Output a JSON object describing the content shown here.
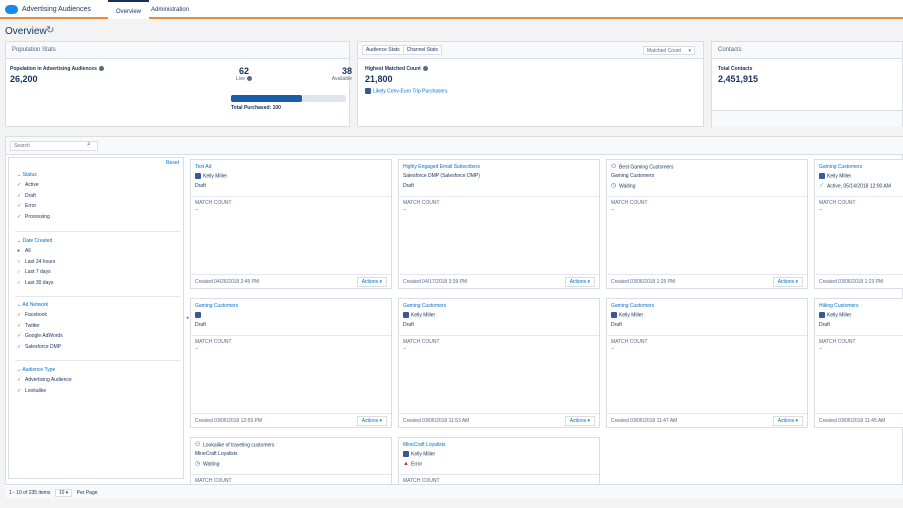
{
  "header": {
    "app_name": "Advertising Audiences",
    "tabs": [
      "Overview",
      "Administration"
    ]
  },
  "page": {
    "title": "Overview"
  },
  "population": {
    "head": "Population Stats",
    "label": "Population in Advertising Audiences",
    "value": "26,200",
    "live_value": "62",
    "live_label": "Live",
    "available_value": "38",
    "available_label": "Available",
    "total_purchased": "Total Purchased: 100",
    "live_fraction": 0.62
  },
  "audience_stats": {
    "tab1": "Audience Stats",
    "tab2": "Channel Stats",
    "select": "Matched Count",
    "label": "Highest Matched Count",
    "value": "21,800",
    "link": "Likely Conv-Euro Trip Purchasers"
  },
  "contacts": {
    "head": "Contacts",
    "label": "Total Contacts",
    "value": "2,451,915"
  },
  "search": {
    "placeholder": "Search"
  },
  "filters": {
    "reset": "Reset",
    "status": {
      "title": "Status",
      "items": [
        "Active",
        "Draft",
        "Error",
        "Processing"
      ]
    },
    "date_created": {
      "title": "Date Created",
      "items": [
        "All",
        "Last 24 hours",
        "Last 7 days",
        "Last 30 days"
      ]
    },
    "ad_network": {
      "title": "Ad Network",
      "items": [
        "Facebook",
        "Twitter",
        "Google AdWords",
        "Salesforce DMP"
      ]
    },
    "audience_type": {
      "title": "Audience Type",
      "items": [
        "Advertising Audience",
        "Lookalike"
      ]
    }
  },
  "cards": [
    {
      "title": "Test Ad",
      "line2": "Kelly Miller",
      "line3": "Draft",
      "mc": "MATCH COUNT",
      "mcv": "--",
      "created": "Created 04/26/2018 2:45 PM",
      "actions": "Actions ▾"
    },
    {
      "title": "Highly Engaged Email Subscribers",
      "line2": "Salesforce DMP (Salesforce DMP)",
      "line3": "Draft",
      "mc": "MATCH COUNT",
      "mcv": "--",
      "created": "Created 04/17/2018 3:39 PM",
      "actions": "Actions ▾"
    },
    {
      "title": "Best Gaming Customers",
      "line2": "Gaming Customers",
      "line3": "Waiting",
      "mc": "MATCH COUNT",
      "mcv": "--",
      "created": "Created 03/06/2018 1:25 PM",
      "actions": "Actions ▾"
    },
    {
      "title": "Gaming Customers",
      "line2": "Kelly Miller",
      "line3": "Active, 05/14/2018 12:00 AM",
      "mc": "MATCH COUNT",
      "mcv": "--",
      "created": "Created 03/06/2018 1:23 PM",
      "actions": ""
    },
    {
      "title": "Gaming Customers",
      "line2": "",
      "line3": "Draft",
      "mc": "MATCH COUNT",
      "mcv": "--",
      "created": "Created 03/06/2018 12:59 PM",
      "actions": "Actions ▾"
    },
    {
      "title": "Gaming Customers",
      "line2": "Kelly Miller",
      "line3": "Draft",
      "mc": "MATCH COUNT",
      "mcv": "--",
      "created": "Created 03/06/2018 11:53 AM",
      "actions": "Actions ▾"
    },
    {
      "title": "Gaming Customers",
      "line2": "Kelly Miller",
      "line3": "Draft",
      "mc": "MATCH COUNT",
      "mcv": "--",
      "created": "Created 03/06/2018 11:47 AM",
      "actions": "Actions ▾"
    },
    {
      "title": "Hiking Customers",
      "line2": "Kelly Miller",
      "line3": "Draft",
      "mc": "MATCH COUNT",
      "mcv": "--",
      "created": "Created 03/06/2018 11:45 AM",
      "actions": ""
    },
    {
      "title": "Lookalike of traveling customers",
      "line2": "MineCraft Loyalists",
      "line3": "Waiting",
      "mc": "MATCH COUNT",
      "mcv": "",
      "created": "",
      "actions": ""
    },
    {
      "title": "MineCraft Loyalists",
      "line2": "Kelly Miller",
      "line3": "Error",
      "mc": "MATCH COUNT",
      "mcv": "",
      "created": "",
      "actions": ""
    }
  ],
  "pagination": {
    "range": "1 - 10 of 235 items",
    "per_page_value": "10",
    "per_page_label": "Per Page"
  },
  "colors": {
    "accent": "#e88a3b",
    "link": "#0070d2",
    "facebook": "#3b5998",
    "progress": "#1a5dab",
    "error": "#c23934"
  }
}
